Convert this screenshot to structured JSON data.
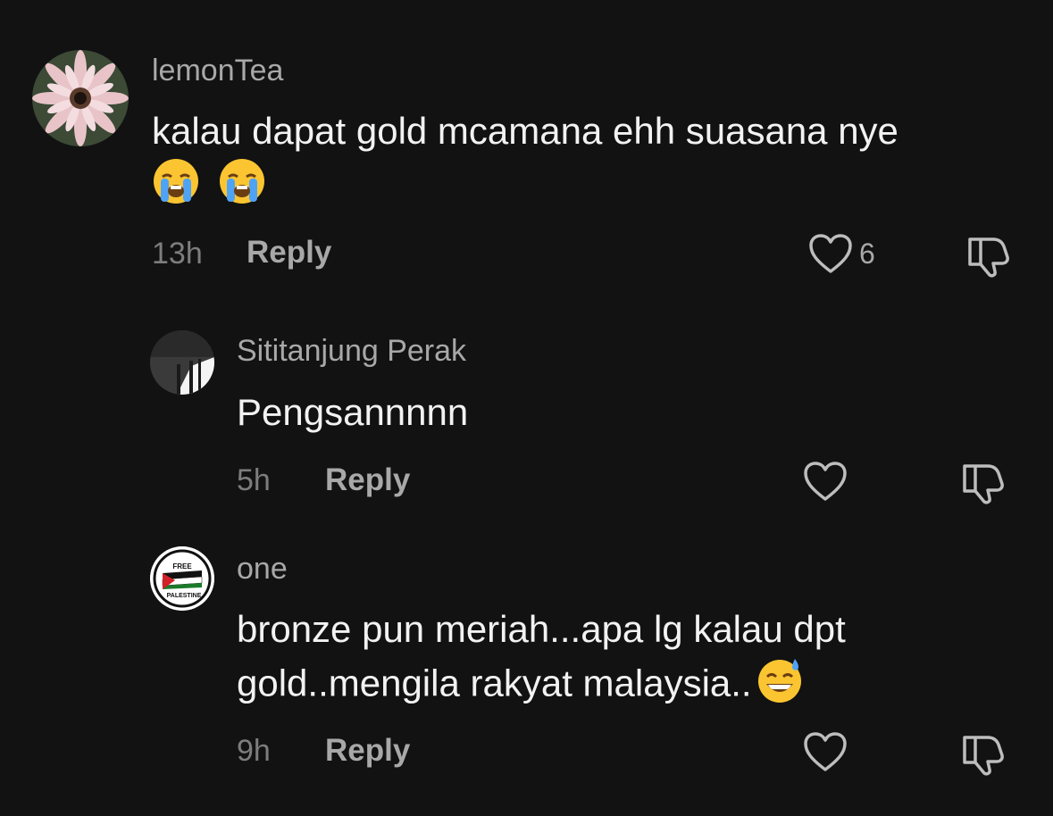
{
  "comments": [
    {
      "username": "lemonTea",
      "text_line1": "kalau dapat gold mcamana ehh suasana nye",
      "emoji": [
        "loudly-crying-face",
        "loudly-crying-face"
      ],
      "time": "13h",
      "reply_label": "Reply",
      "likes": "6"
    },
    {
      "username": "Sititanjung Perak",
      "text": "Pengsannnnn",
      "time": "5h",
      "reply_label": "Reply"
    },
    {
      "username": "one",
      "text_line1": "bronze pun meriah...apa lg kalau dpt",
      "text_line2": "gold..mengila rakyat malaysia..",
      "emoji": [
        "grinning-face-with-sweat"
      ],
      "avatar_text_top": "FREE",
      "avatar_text_bottom": "PALESTINE",
      "time": "9h",
      "reply_label": "Reply"
    }
  ],
  "colors": {
    "background": "#121212",
    "username": "#a8a8a8",
    "text": "#f2f2f2",
    "meta": "#7d7d7d"
  }
}
